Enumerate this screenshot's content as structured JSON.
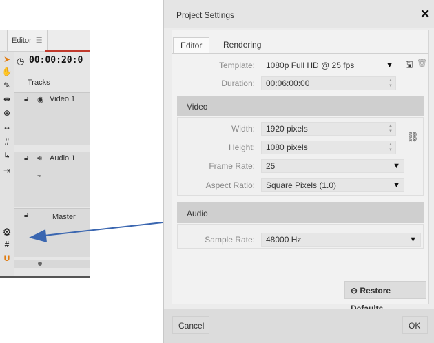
{
  "editor": {
    "tab_label": "Editor",
    "timecode": "00:00:20:0",
    "tracks_label": "Tracks",
    "tracks": [
      {
        "name": "Video 1"
      },
      {
        "name": "Audio 1"
      },
      {
        "name": "Master"
      }
    ]
  },
  "dialog": {
    "title": "Project Settings",
    "close_glyph": "✕",
    "tabs": [
      {
        "label": "Editor",
        "active": true
      },
      {
        "label": "Rendering",
        "active": false
      }
    ],
    "template": {
      "label": "Template:",
      "value": "1080p Full HD @ 25 fps"
    },
    "duration": {
      "label": "Duration:",
      "value": "00:06:00:00"
    },
    "video": {
      "section_label": "Video",
      "width": {
        "label": "Width:",
        "value": "1920 pixels"
      },
      "height": {
        "label": "Height:",
        "value": "1080 pixels"
      },
      "frame_rate": {
        "label": "Frame Rate:",
        "value": "25"
      },
      "aspect_ratio": {
        "label": "Aspect Ratio:",
        "value": "Square Pixels (1.0)"
      }
    },
    "audio": {
      "section_label": "Audio",
      "sample_rate": {
        "label": "Sample Rate:",
        "value": "48000 Hz"
      }
    },
    "restore_defaults_label": "Restore Defaults",
    "cancel_label": "Cancel",
    "ok_label": "OK"
  },
  "colors": {
    "arrow": "#3a66b0",
    "accent_red": "#c0392b",
    "accent_orange": "#e07b10"
  },
  "icons": {
    "selection_tool": "arrow-pointer-icon",
    "hand_tool": "hand-icon",
    "razor_tool": "razor-icon",
    "settings": "gear-icon",
    "snap": "magnet-icon",
    "link": "link-icon"
  }
}
